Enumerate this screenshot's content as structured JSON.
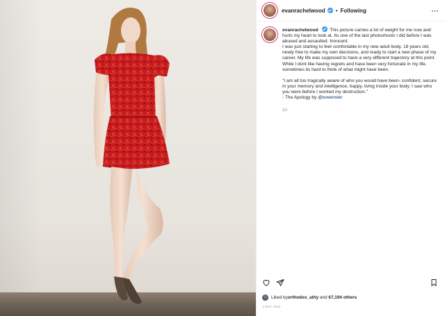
{
  "post": {
    "username": "evanrachelwood",
    "verified": true,
    "follow_status": "Following",
    "more_icon": "ellipsis-icon",
    "caption": {
      "username": "evanrachelwood",
      "paragraph1": "This picture carries a lot of weight for me now and hurts my heart to look at. Its one of the last photoshoots I did before I was abused and assaulted. Innocent.",
      "paragraph2": "I was just starting to feel comfortable in my new adult body. 18 years old, newly free to make my own decisions, and ready to start a new phase of my career. My life was supposed to have a very different trajectory at this point.",
      "paragraph3": "While I dont like having regrets and have been very fortunate in my life, sometimes its hard to think of what might have been.",
      "quote": "\"I am all too tragically aware of who you would have been- confident, secure in your memory and intelligence, happy, living inside your body. I saw who you were before I worked my destruction.\"",
      "attribution_prefix": "- The Apology by ",
      "attribution_mention": "@eveensler",
      "timestamp": "1d"
    },
    "actions": {
      "like_icon": "heart-icon",
      "share_icon": "send-icon",
      "save_icon": "bookmark-icon"
    },
    "likes": {
      "prefix": "Liked by ",
      "user": "orthodox_athy",
      "middle": " and ",
      "count": "67,194 others"
    },
    "posted_ago": "1 DAY AGO"
  },
  "colors": {
    "dress_red": "#c8191c",
    "verified_blue": "#3897f0",
    "mention_blue": "#00376b",
    "muted_gray": "#8e8e8e"
  }
}
